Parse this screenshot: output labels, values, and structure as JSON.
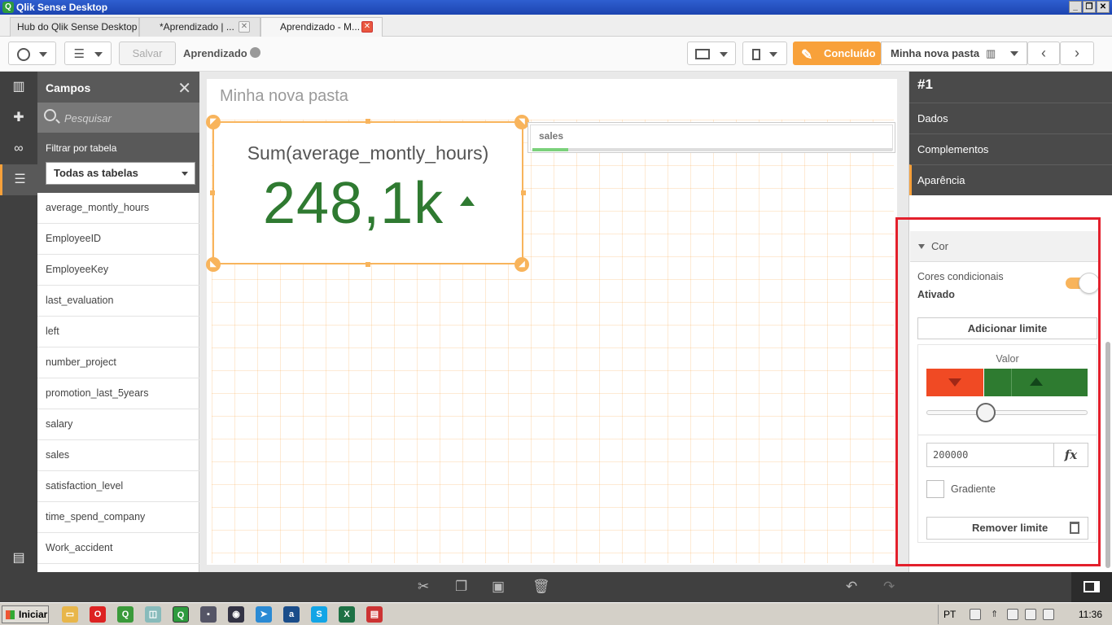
{
  "window": {
    "title": "Qlik Sense Desktop",
    "app_icon": "qlik-icon"
  },
  "tabs": [
    {
      "label": "Hub do Qlik Sense Desktop"
    },
    {
      "label": "*Aprendizado | ..."
    },
    {
      "label": "Aprendizado - M..."
    }
  ],
  "toolbar": {
    "save_label": "Salvar",
    "app_name": "Aprendizado",
    "done_label": "Concluído",
    "sheet_name": "Minha nova pasta"
  },
  "fields_panel": {
    "title": "Campos",
    "search_placeholder": "Pesquisar",
    "filter_label": "Filtrar por tabela",
    "table_select": "Todas as tabelas",
    "fields": [
      "average_montly_hours",
      "EmployeeID",
      "EmployeeKey",
      "last_evaluation",
      "left",
      "number_project",
      "promotion_last_5years",
      "salary",
      "sales",
      "satisfaction_level",
      "time_spend_company",
      "Work_accident"
    ]
  },
  "sheet": {
    "title": "Minha nova pasta",
    "kpi": {
      "label": "Sum(average_montly_hours)",
      "value": "248,1k",
      "trend": "up",
      "color": "#2f7a31"
    },
    "filter_pane": {
      "label": "sales"
    }
  },
  "properties": {
    "object_id": "#1",
    "tabs": [
      "Dados",
      "Complementos",
      "Aparência"
    ],
    "section": "Cor",
    "conditional_colors_label": "Cores condicionais",
    "conditional_colors_value": "Ativado",
    "add_limit_label": "Adicionar limite",
    "value_label": "Valor",
    "low_color": "#f04a24",
    "high_color": "#2e7b30",
    "limit_value": "200000",
    "fx_label": "fx",
    "gradient_label": "Gradiente",
    "remove_limit_label": "Remover limite"
  },
  "taskbar": {
    "start_label": "Iniciar",
    "language": "PT",
    "clock": "11:36"
  }
}
